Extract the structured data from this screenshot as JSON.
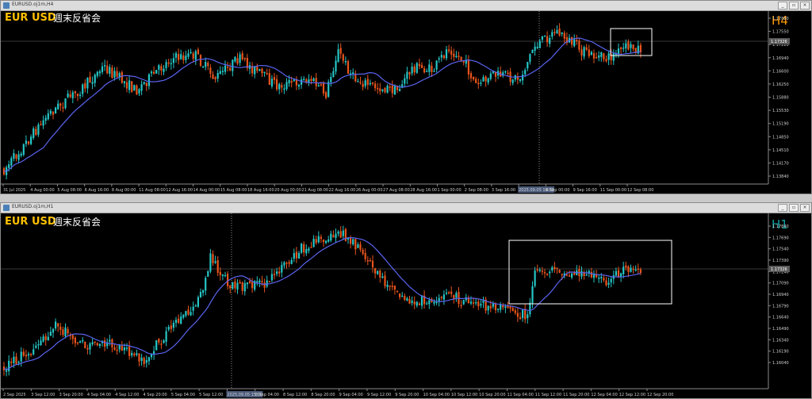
{
  "colors": {
    "background": "#000000",
    "bull": "#26c6c6",
    "bear": "#e8541c",
    "ma": "#5a64f0",
    "symbol": "#ffc000",
    "tf_h4": "#ff9900",
    "tf_h1": "#11a0a0",
    "grid": "#707070",
    "price_tag": "#5a5a5a"
  },
  "top_window": {
    "title": "EURUSD.oj1m,H4",
    "symbol_label": "EUR USD",
    "jp_label": "週末反省会",
    "timeframe": "H4",
    "current_price": "1.17326",
    "y_ticks": [
      "1.17880",
      "1.17550",
      "1.17220",
      "1.16940",
      "1.16600",
      "1.16250",
      "1.15880",
      "1.15530",
      "1.15190",
      "1.14850",
      "1.14510",
      "1.14170",
      "1.13840"
    ],
    "x_ticks": [
      "31 Jul 2025",
      "4 Aug 00:00",
      "5 Aug 08:00",
      "6 Aug 16:00",
      "8 Aug 00:00",
      "11 Aug 08:00",
      "12 Aug 16:00",
      "14 Aug 00:00",
      "15 Aug 08:00",
      "18 Aug 16:00",
      "20 Aug 00:00",
      "21 Aug 08:00",
      "22 Aug 16:00",
      "26 Aug 00:00",
      "27 Aug 08:00",
      "28 Aug 16:00",
      "1 Sep 00:00",
      "2 Sep 08:00",
      "3 Sep 16:00",
      "2025.09.05 16:00",
      "8 Sep 00:00",
      "9 Sep 16:00",
      "11 Sep 00:00",
      "12 Sep 08:00"
    ]
  },
  "bottom_window": {
    "title": "EURUSD.oj1m,H1",
    "symbol_label": "EUR USD",
    "jp_label": "週末反省会",
    "timeframe": "H1",
    "current_price": "1.17326",
    "y_ticks": [
      "1.17840",
      "1.17690",
      "1.17540",
      "1.17390",
      "1.17240",
      "1.17090",
      "1.16940",
      "1.16790",
      "1.16640",
      "1.16490",
      "1.16340",
      "1.16190",
      "1.16040"
    ],
    "x_ticks": [
      "2 Sep 2025",
      "3 Sep 12:00",
      "3 Sep 20:00",
      "4 Sep 04:00",
      "4 Sep 12:00",
      "4 Sep 20:00",
      "5 Sep 04:00",
      "5 Sep 12:00",
      "2025.09.05 15:00",
      "8 Sep 04:00",
      "8 Sep 12:00",
      "8 Sep 20:00",
      "9 Sep 04:00",
      "9 Sep 12:00",
      "9 Sep 20:00",
      "10 Sep 04:00",
      "10 Sep 12:00",
      "10 Sep 20:00",
      "11 Sep 04:00",
      "11 Sep 12:00",
      "11 Sep 20:00",
      "12 Sep 04:00",
      "12 Sep 12:00",
      "12 Sep 20:00"
    ]
  }
}
